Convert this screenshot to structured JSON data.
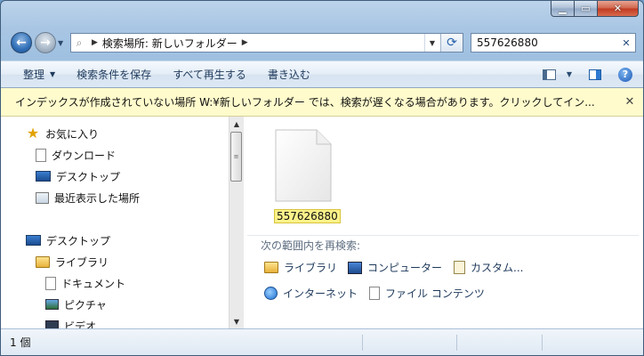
{
  "address": {
    "crumbs": [
      "検索場所: 新しいフォルダー"
    ]
  },
  "search": {
    "value": "557626880"
  },
  "toolbar": {
    "organize_label": "整理",
    "save_search_label": "検索条件を保存",
    "play_all_label": "すべて再生する",
    "burn_label": "書き込む"
  },
  "infobar": {
    "message": "インデックスが作成されていない場所 W:¥新しいフォルダー では、検索が遅くなる場合があります。クリックしてイン..."
  },
  "nav": {
    "favorites_label": "お気に入り",
    "items": [
      {
        "label": "ダウンロード"
      },
      {
        "label": "デスクトップ"
      },
      {
        "label": "最近表示した場所"
      }
    ],
    "desktop_label": "デスクトップ",
    "libraries_label": "ライブラリ",
    "library_items": [
      {
        "label": "ドキュメント"
      },
      {
        "label": "ピクチャ"
      },
      {
        "label": "ビデオ"
      }
    ]
  },
  "content": {
    "file_name": "557626880",
    "search_again_label": "次の範囲内を再検索:",
    "search_again_items": [
      {
        "label": "ライブラリ"
      },
      {
        "label": "コンピューター"
      },
      {
        "label": "カスタム..."
      },
      {
        "label": "インターネット"
      },
      {
        "label": "ファイル コンテンツ"
      }
    ]
  },
  "status": {
    "count": "1 個"
  },
  "colors": {
    "infobar_bg": "#fffbcc",
    "selection_highlight": "#fcf28a",
    "close_button": "#c0391f"
  }
}
